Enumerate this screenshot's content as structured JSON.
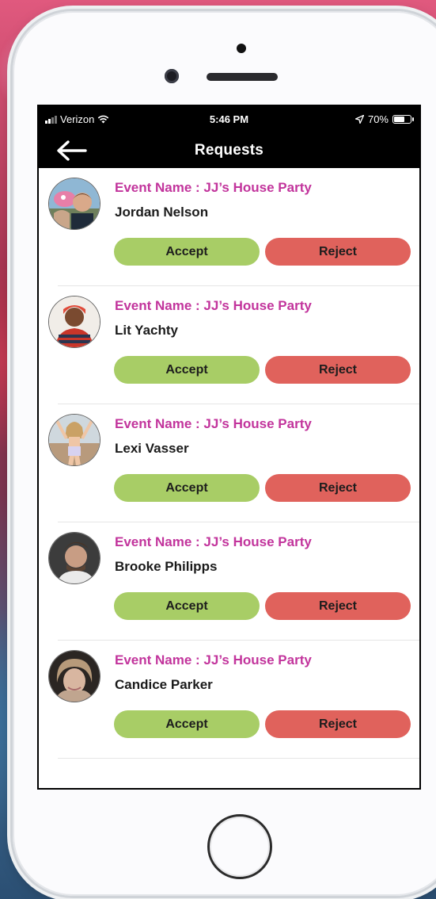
{
  "status_bar": {
    "carrier": "Verizon",
    "time": "5:46 PM",
    "battery": "70%",
    "battery_level": 0.7
  },
  "nav": {
    "title": "Requests",
    "back_icon": "arrow-left-icon"
  },
  "requests": [
    {
      "event": "Event Name : JJ’s House Party",
      "name": "Jordan Nelson",
      "accept": "Accept",
      "reject": "Reject"
    },
    {
      "event": "Event Name : JJ’s House Party",
      "name": "Lit Yachty",
      "accept": "Accept",
      "reject": "Reject"
    },
    {
      "event": "Event Name : JJ’s House Party",
      "name": "Lexi Vasser",
      "accept": "Accept",
      "reject": "Reject"
    },
    {
      "event": "Event Name : JJ’s House Party",
      "name": "Brooke Philipps",
      "accept": "Accept",
      "reject": "Reject"
    },
    {
      "event": "Event Name : JJ’s House Party",
      "name": "Candice Parker",
      "accept": "Accept",
      "reject": "Reject"
    }
  ],
  "colors": {
    "event_name": "#c2349c",
    "accept": "#a8cd66",
    "reject": "#e0625c",
    "header": "#000000"
  }
}
